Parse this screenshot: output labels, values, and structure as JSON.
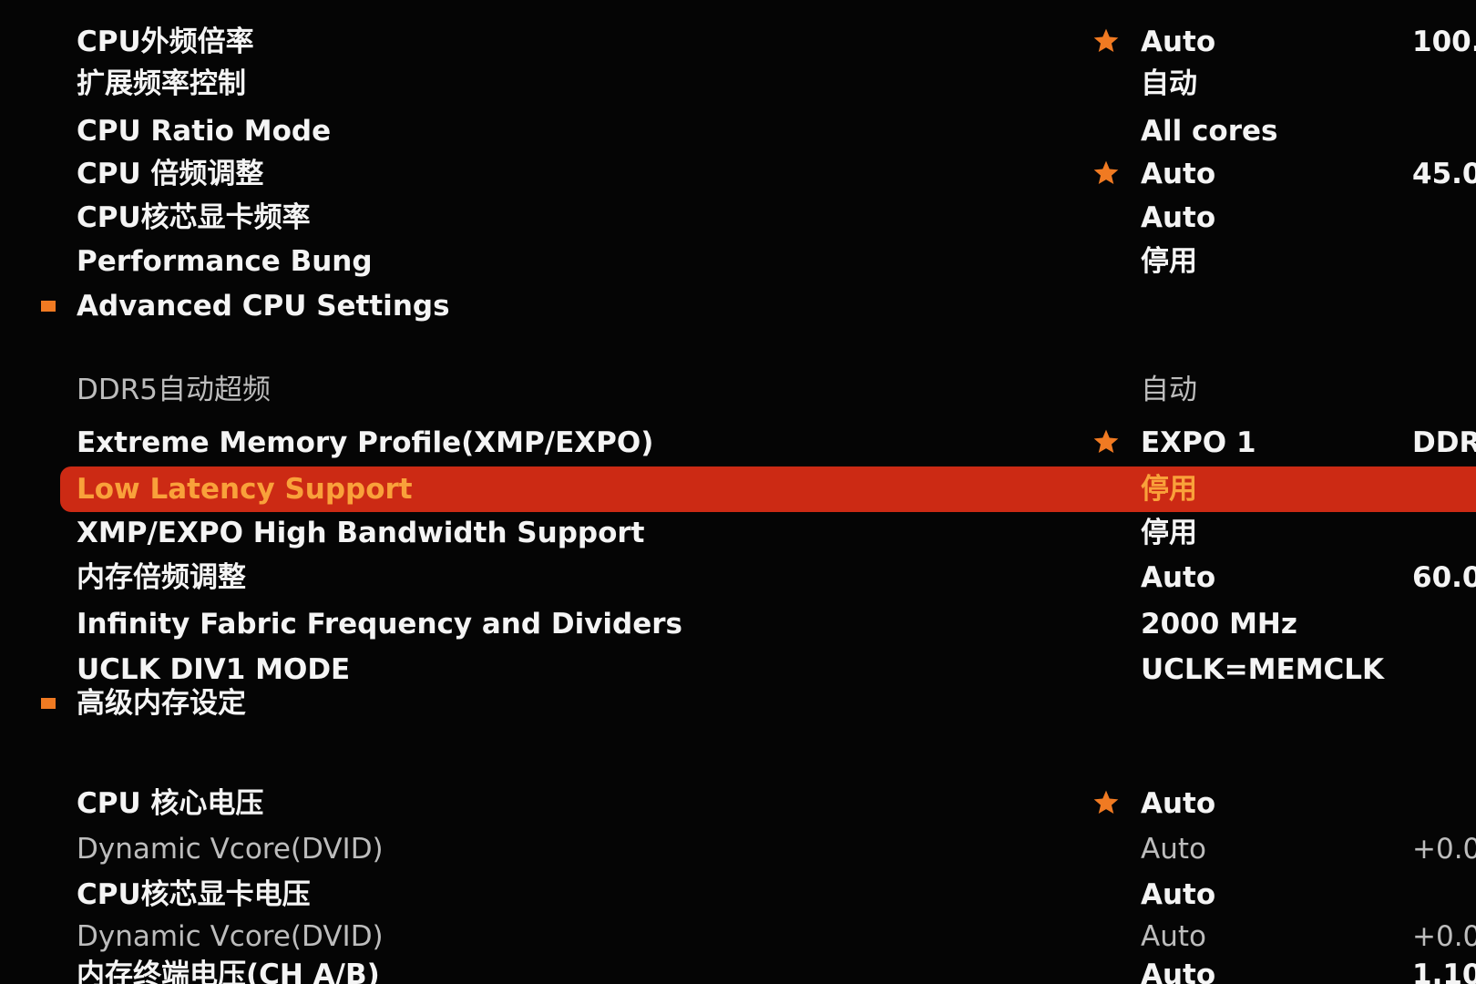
{
  "accent_color": "#f07a22",
  "highlight_color": "#cc2a14",
  "rows": [
    {
      "label": "CPU外频倍率",
      "value": "Auto",
      "extra": "100.",
      "starred": true,
      "bullet": false,
      "dim": false
    },
    {
      "label": "扩展频率控制",
      "value": "自动",
      "extra": "",
      "starred": false,
      "bullet": false,
      "dim": false
    },
    {
      "label": "CPU Ratio Mode",
      "value": "All cores",
      "extra": "",
      "starred": false,
      "bullet": false,
      "dim": false
    },
    {
      "label": "CPU 倍频调整",
      "value": "Auto",
      "extra": "45.0",
      "starred": true,
      "bullet": false,
      "dim": false
    },
    {
      "label": "CPU核芯显卡频率",
      "value": "Auto",
      "extra": "",
      "starred": false,
      "bullet": false,
      "dim": false
    },
    {
      "label": "Performance Bung",
      "value": "停用",
      "extra": "",
      "starred": false,
      "bullet": false,
      "dim": false
    },
    {
      "label": "Advanced CPU Settings",
      "value": "",
      "extra": "",
      "starred": false,
      "bullet": true,
      "dim": false
    },
    {
      "label": "DDR5自动超频",
      "value": "自动",
      "extra": "",
      "starred": false,
      "bullet": false,
      "dim": true
    },
    {
      "label": "Extreme Memory Profile(XMP/EXPO)",
      "value": "EXPO 1",
      "extra": "DDR",
      "starred": true,
      "bullet": false,
      "dim": false
    },
    {
      "label": "Low Latency Support",
      "value": "停用",
      "extra": "",
      "starred": false,
      "bullet": false,
      "dim": false,
      "selected": true
    },
    {
      "label": "XMP/EXPO High Bandwidth Support",
      "value": "停用",
      "extra": "",
      "starred": false,
      "bullet": false,
      "dim": false
    },
    {
      "label": "内存倍频调整",
      "value": "Auto",
      "extra": "60.0",
      "starred": false,
      "bullet": false,
      "dim": false
    },
    {
      "label": "Infinity Fabric Frequency and Dividers",
      "value": "2000 MHz",
      "extra": "",
      "starred": false,
      "bullet": false,
      "dim": false
    },
    {
      "label": "UCLK DIV1 MODE",
      "value": "UCLK=MEMCLK",
      "extra": "",
      "starred": false,
      "bullet": false,
      "dim": false
    },
    {
      "label": "高级内存设定",
      "value": "",
      "extra": "",
      "starred": false,
      "bullet": true,
      "dim": false
    },
    {
      "label": "CPU 核心电压",
      "value": "Auto",
      "extra": "",
      "starred": true,
      "bullet": false,
      "dim": false
    },
    {
      "label": "Dynamic Vcore(DVID)",
      "value": "Auto",
      "extra": "+0.0",
      "starred": false,
      "bullet": false,
      "dim": true
    },
    {
      "label": "CPU核芯显卡电压",
      "value": "Auto",
      "extra": "",
      "starred": false,
      "bullet": false,
      "dim": false
    },
    {
      "label": "Dynamic Vcore(DVID)",
      "value": "Auto",
      "extra": "+0.0",
      "starred": false,
      "bullet": false,
      "dim": true
    },
    {
      "label": "内存终端电压(CH A/B)",
      "value": "Auto",
      "extra": "1.10",
      "starred": false,
      "bullet": false,
      "dim": false
    }
  ]
}
